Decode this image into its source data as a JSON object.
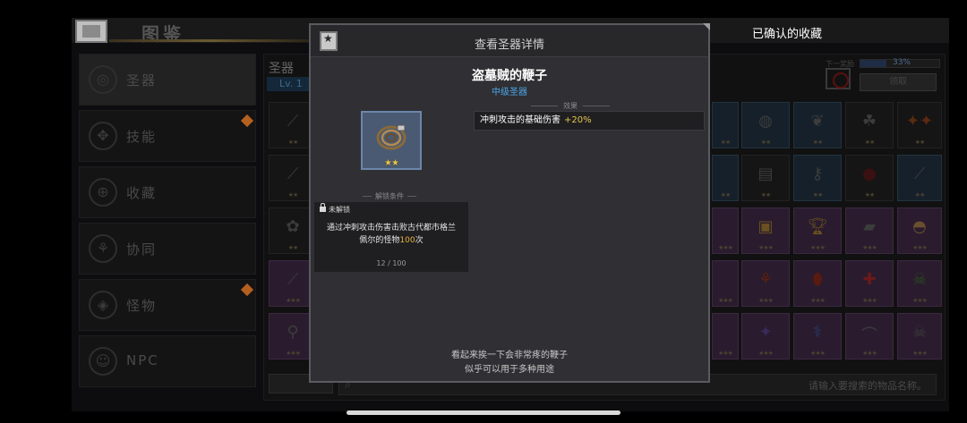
{
  "header": {
    "title": "图鉴",
    "confirmed_label": "已确认的收藏"
  },
  "sidebar": {
    "items": [
      {
        "label": "圣器",
        "icon": "relic-icon",
        "active": true,
        "alert": false
      },
      {
        "label": "技能",
        "icon": "skill-icon",
        "active": false,
        "alert": true
      },
      {
        "label": "收藏",
        "icon": "collection-icon",
        "active": false,
        "alert": false
      },
      {
        "label": "协同",
        "icon": "synergy-icon",
        "active": false,
        "alert": false
      },
      {
        "label": "怪物",
        "icon": "monster-icon",
        "active": false,
        "alert": true
      },
      {
        "label": "NPC",
        "icon": "npc-icon",
        "active": false,
        "alert": false
      }
    ]
  },
  "collection_panel": {
    "tab_label": "圣器",
    "level_badge": "Lv. 1",
    "next_bonus_label": "下一奖励",
    "progress_percent": 33,
    "progress_text": "33%",
    "claim_button": "领取"
  },
  "bottom_bar": {
    "sort_label": "",
    "search_placeholder": "请输入要搜索的物品名称。"
  },
  "modal": {
    "title": "查看圣器详情",
    "item_name": "盗墓贼的鞭子",
    "rarity": "中级圣器",
    "stars": 2,
    "effect_header": "效果",
    "effect_text": "冲刺攻击的基础伤害",
    "effect_bonus": "+20%",
    "unlock_header": "解锁条件",
    "lock_status": "未解锁",
    "condition_line1": "通过冲刺攻击伤害击败古代都市格兰",
    "condition_line2_prefix": "佩尔的怪物",
    "condition_count": "100",
    "condition_line2_suffix": "次",
    "progress_text": "12 / 100",
    "flavor_line1": "看起来挨一下会非常疼的鞭子",
    "flavor_line2": "似乎可以用于多种用途"
  },
  "colors": {
    "rarity_blue": "#4aa5e8",
    "bonus_gold": "#e8c64a",
    "modal_bg": "#302f33"
  }
}
